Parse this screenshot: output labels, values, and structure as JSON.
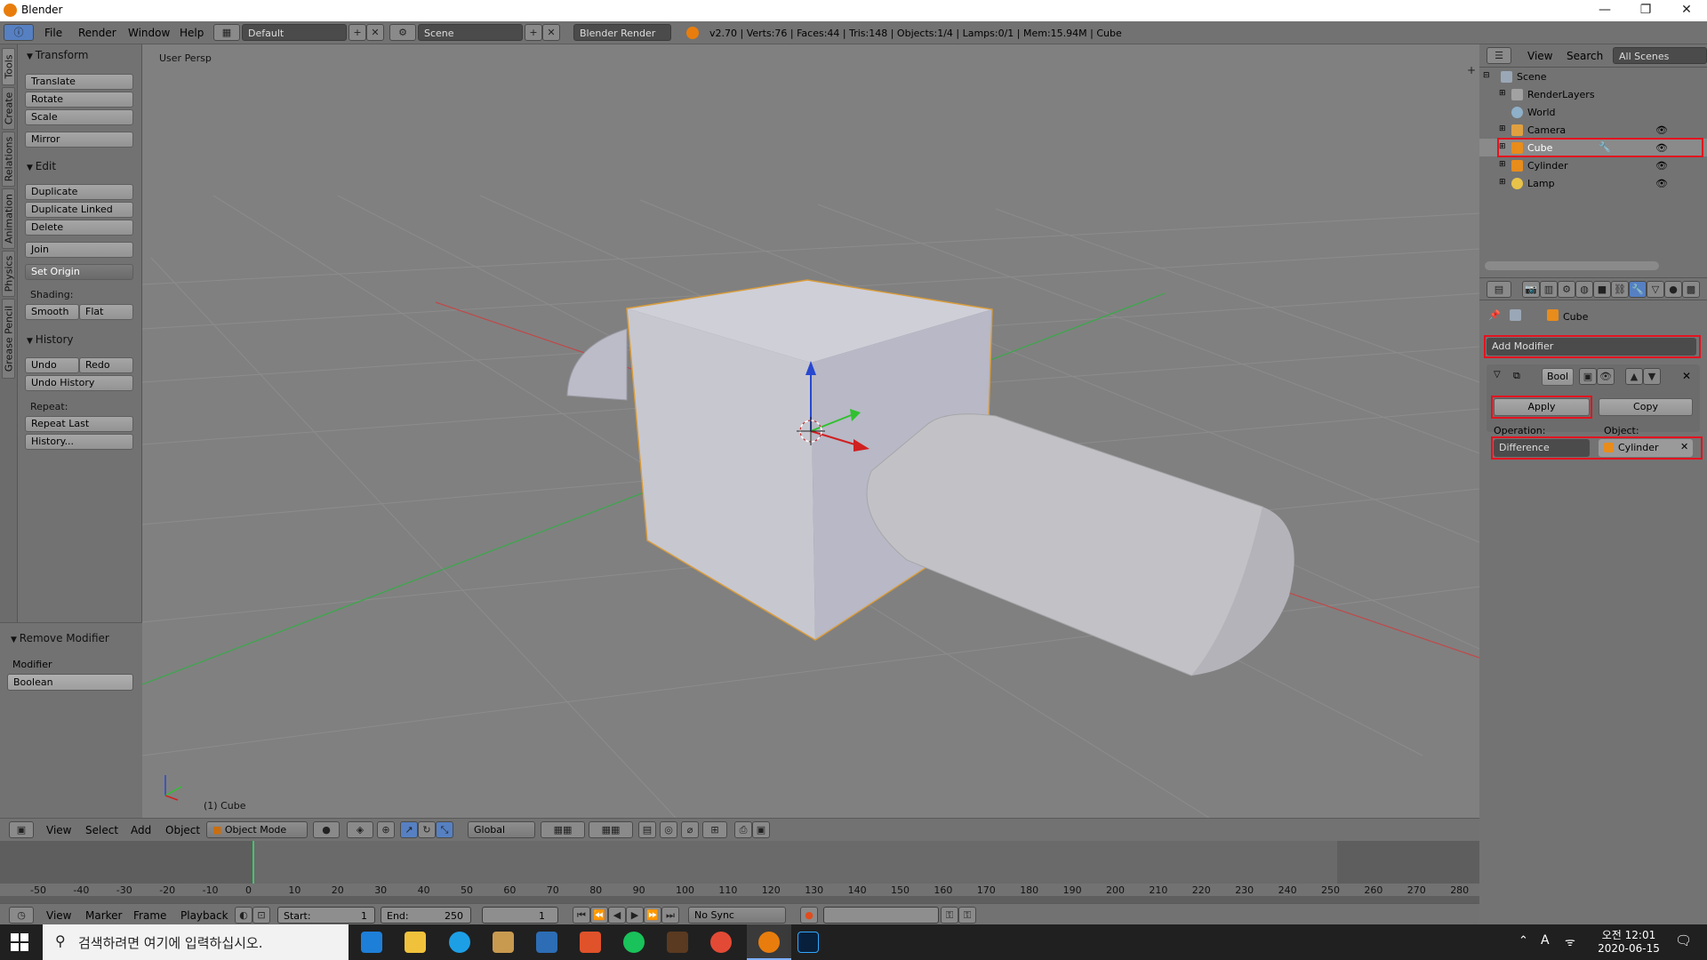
{
  "window": {
    "title": "Blender"
  },
  "menu": [
    "File",
    "Render",
    "Window",
    "Help"
  ],
  "screen_layout": "Default",
  "scene": "Scene",
  "render_engine": "Blender Render",
  "stats": "v2.70 | Verts:76 | Faces:44 | Tris:148 | Objects:1/4 | Lamps:0/1 | Mem:15.94M | Cube",
  "tabs": [
    "Tools",
    "Create",
    "Relations",
    "Animation",
    "Physics",
    "Grease Pencil"
  ],
  "tools": {
    "transform_h": "Transform",
    "translate": "Translate",
    "rotate": "Rotate",
    "scale": "Scale",
    "mirror": "Mirror",
    "edit_h": "Edit",
    "duplicate": "Duplicate",
    "duplicate_linked": "Duplicate Linked",
    "delete": "Delete",
    "join": "Join",
    "set_origin": "Set Origin",
    "shading": "Shading:",
    "smooth": "Smooth",
    "flat": "Flat",
    "history_h": "History",
    "undo": "Undo",
    "redo": "Redo",
    "undo_history": "Undo History",
    "repeat": "Repeat:",
    "repeat_last": "Repeat Last",
    "history": "History..."
  },
  "operator": {
    "title": "Remove Modifier",
    "modifier_label": "Modifier",
    "modifier_value": "Boolean"
  },
  "viewport": {
    "persp": "User Persp",
    "object_label": "(1) Cube"
  },
  "view3d_header": {
    "view": "View",
    "select": "Select",
    "add": "Add",
    "object": "Object",
    "mode": "Object Mode",
    "orientation": "Global"
  },
  "timeline": {
    "ticks": [
      "-50",
      "-40",
      "-30",
      "-20",
      "-10",
      "0",
      "10",
      "20",
      "30",
      "40",
      "50",
      "60",
      "70",
      "80",
      "90",
      "100",
      "110",
      "120",
      "130",
      "140",
      "150",
      "160",
      "170",
      "180",
      "190",
      "200",
      "210",
      "220",
      "230",
      "240",
      "250",
      "260",
      "270",
      "280"
    ],
    "view": "View",
    "marker": "Marker",
    "frame": "Frame",
    "playback": "Playback",
    "start_label": "Start:",
    "start": "1",
    "end_label": "End:",
    "end": "250",
    "current": "1",
    "sync": "No Sync"
  },
  "outliner": {
    "view": "View",
    "search": "Search",
    "filter": "All Scenes",
    "items": [
      "Scene",
      "RenderLayers",
      "World",
      "Camera",
      "Cube",
      "Cylinder",
      "Lamp"
    ]
  },
  "properties": {
    "object_name": "Cube",
    "add_modifier": "Add Modifier",
    "mod_name": "Bool",
    "apply": "Apply",
    "copy": "Copy",
    "operation_label": "Operation:",
    "object_label": "Object:",
    "operation": "Difference",
    "target": "Cylinder"
  },
  "taskbar": {
    "search_placeholder": "검색하려면 여기에 입력하십시오.",
    "time": "오전 12:01",
    "date": "2020-06-15",
    "lang": "A"
  },
  "colors": {
    "highlight": "#e3131f",
    "accent": "#e87d0d",
    "selected": "#5680c2"
  }
}
